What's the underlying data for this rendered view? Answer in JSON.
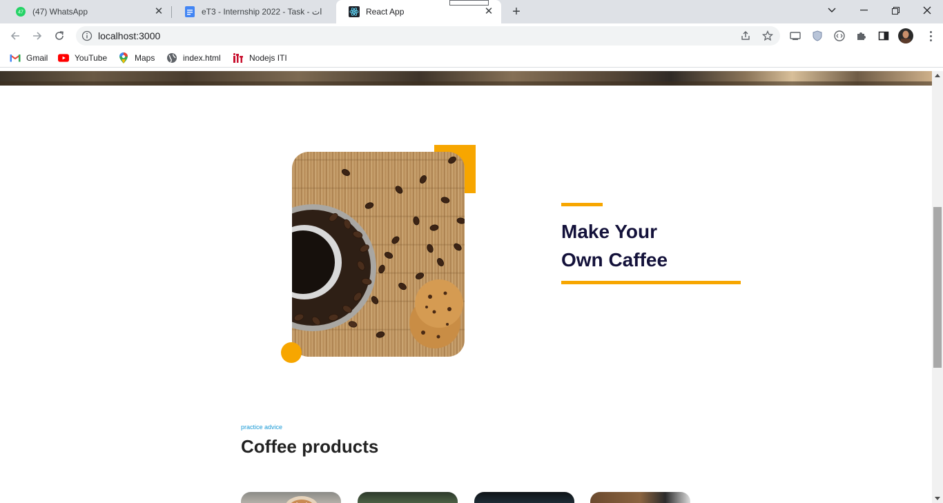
{
  "browser": {
    "tabs": [
      {
        "title": "(47) WhatsApp",
        "badge": "47",
        "icon": "whatsapp-icon"
      },
      {
        "title": "eT3 - Internship 2022 - Task - ات",
        "icon": "google-docs-icon"
      },
      {
        "title": "React App",
        "icon": "react-icon"
      }
    ],
    "url": "localhost:3000",
    "bookmarks": [
      {
        "label": "Gmail",
        "icon": "gmail-icon"
      },
      {
        "label": "YouTube",
        "icon": "youtube-icon"
      },
      {
        "label": "Maps",
        "icon": "maps-icon"
      },
      {
        "label": "index.html",
        "icon": "globe-icon"
      },
      {
        "label": "Nodejs ITI",
        "icon": "iti-icon"
      }
    ]
  },
  "page": {
    "feature": {
      "title_line1": "Make Your",
      "title_line2": "Own Caffee",
      "image_icon": "coffee-photo"
    },
    "products": {
      "eyebrow": "practice advice",
      "title": "Coffee products"
    }
  },
  "colors": {
    "accent": "#f7a600",
    "heading": "#13113a",
    "eyebrow": "#1a9ad6"
  }
}
